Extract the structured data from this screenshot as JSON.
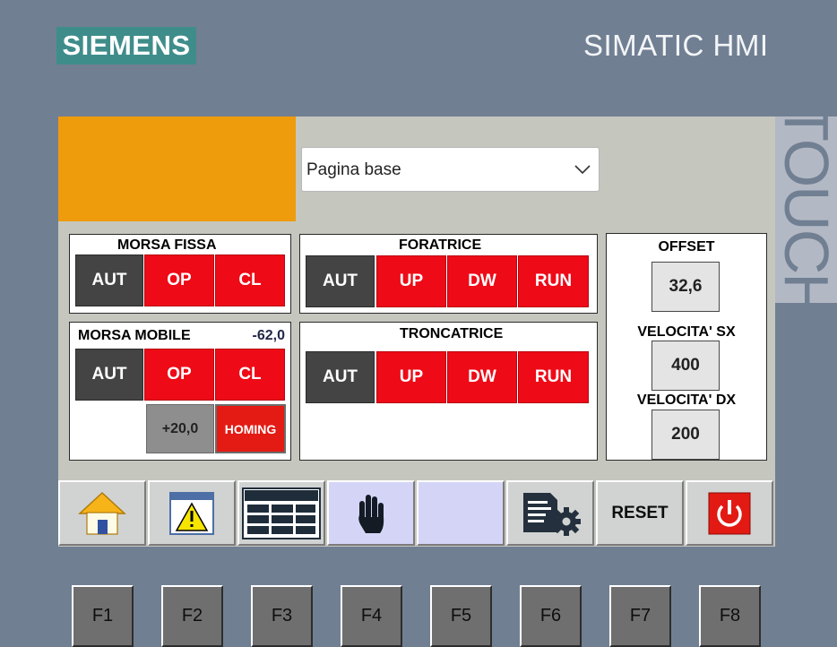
{
  "device": {
    "brand": "SIEMENS",
    "model": "SIMATIC HMI",
    "side_label": "TOUCH"
  },
  "screen_select": {
    "value": "Pagina base"
  },
  "morsa_fissa": {
    "title": "MORSA FISSA",
    "buttons": [
      "AUT",
      "OP",
      "CL"
    ]
  },
  "foratrice": {
    "title": "FORATRICE",
    "buttons": [
      "AUT",
      "UP",
      "DW",
      "RUN"
    ]
  },
  "morsa_mobile": {
    "title": "MORSA MOBILE",
    "position": "-62,0",
    "buttons": [
      "AUT",
      "OP",
      "CL"
    ],
    "step_value": "+20,0",
    "homing_label": "HOMING"
  },
  "troncatrice": {
    "title": "TRONCATRICE",
    "buttons": [
      "AUT",
      "UP",
      "DW",
      "RUN"
    ]
  },
  "settings": {
    "offset_label": "OFFSET",
    "offset_value": "32,6",
    "vel_sx_label": "VELOCITA' SX",
    "vel_sx_value": "400",
    "vel_dx_label": "VELOCITA' DX",
    "vel_dx_value": "200"
  },
  "navbar": {
    "reset_label": "RESET"
  },
  "function_keys": [
    "F1",
    "F2",
    "F3",
    "F4",
    "F5",
    "F6",
    "F7",
    "F8"
  ],
  "colors": {
    "accent_red": "#ee0a17",
    "auto_dark": "#444444",
    "logo_orange": "#ee9b0c",
    "bezel": "#717f93",
    "brand_teal": "#3f8d8b"
  },
  "icons": [
    "home-icon",
    "alarm-warning-icon",
    "table-icon",
    "hand-stop-icon",
    "document-settings-icon",
    "power-icon"
  ]
}
